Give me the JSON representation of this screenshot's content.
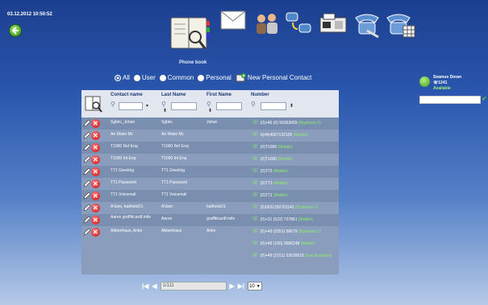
{
  "header": {
    "datetime": "03.12.2012  10:50:52",
    "section_label": "Phone book"
  },
  "toolbar": {
    "icons": [
      "phonebook-icon",
      "mail-icon",
      "users-icon",
      "call-transfer-icon",
      "fax-icon",
      "phone-settings-icon",
      "phone-keypad-icon"
    ]
  },
  "filters": {
    "options": [
      "All",
      "User",
      "Common",
      "Personal"
    ],
    "selected": "All",
    "new_contact_label": "New Personal Contact"
  },
  "user": {
    "name": "Seamus Doran",
    "ext": "1241",
    "status": "Available"
  },
  "table": {
    "columns": [
      "Contact name",
      "Last Name",
      "First Name",
      "Number"
    ],
    "rows": [
      {
        "contact": "Sgbkc_Johan",
        "last": "Sgbkc",
        "first": "Johan",
        "numbers": [
          {
            "num": "(0)+46 (0) 56363659",
            "label": "(Business 1)"
          }
        ]
      },
      {
        "contact": "Ae Wake Mr.",
        "last": "Ae Wake Mr.",
        "first": "",
        "numbers": [
          {
            "num": "0(44)4067132105",
            "label": "(Mobile)"
          }
        ]
      },
      {
        "contact": "T1000 Ref Enq",
        "last": "T1000 Ref Enq",
        "first": "",
        "numbers": [
          {
            "num": "(0)T1000",
            "label": "(Mobile)"
          }
        ]
      },
      {
        "contact": "T1000 Int Enq",
        "last": "T1000 Int Enq",
        "first": "",
        "numbers": [
          {
            "num": "(0)T1000",
            "label": "(Mobile)"
          }
        ]
      },
      {
        "contact": "T71 Greeting",
        "last": "T71 Greeting",
        "first": "",
        "numbers": [
          {
            "num": "(0)T72",
            "label": "(Mobile)"
          }
        ]
      },
      {
        "contact": "T71 Password",
        "last": "T71 Password",
        "first": "",
        "numbers": [
          {
            "num": "(0)T73",
            "label": "(Mobile)"
          }
        ]
      },
      {
        "contact": "T71 Voicemail",
        "last": "T71 Voicemail",
        "first": "",
        "numbers": [
          {
            "num": "(0)T71",
            "label": "(Mobile)"
          }
        ]
      },
      {
        "contact": "A'dam, balthelsD1",
        "last": "A'dam",
        "first": "balthelsD1",
        "numbers": [
          {
            "num": "(0)0031250761141",
            "label": "(Business 1)"
          }
        ]
      },
      {
        "contact": "Aaron graffiticardf.mile",
        "last": "Aaron",
        "first": "graffiticardf.mile",
        "numbers": [
          {
            "num": "(0)+31 (522) 737861",
            "label": "(Mobile)"
          }
        ]
      },
      {
        "contact": "Abbenhaus, Anke",
        "last": "Abbenhaus",
        "first": "Anke",
        "numbers": [
          {
            "num": "(0)+49 (2551) 58679",
            "label": "(Business 1)"
          },
          {
            "num": "(0)+49 (160) 3686248",
            "label": "(Mobile)"
          },
          {
            "num": "(0)+49 (2151) 33639518",
            "label": "(Fax Business)"
          }
        ]
      }
    ]
  },
  "pager": {
    "page_value": "1/111",
    "page_size": "10",
    "first_label": "|◀",
    "prev_label": "◀",
    "next_label": "▶",
    "last_label": "▶|"
  }
}
